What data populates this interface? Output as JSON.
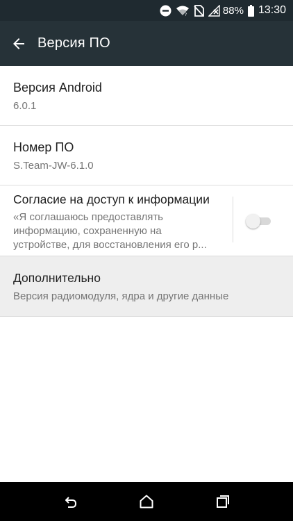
{
  "status_bar": {
    "battery_percent": "88%",
    "time": "13:30",
    "icons": [
      "do-not-disturb-icon",
      "wifi-icon",
      "no-sim-icon",
      "signal-icon",
      "battery-icon"
    ]
  },
  "app_bar": {
    "title": "Версия ПО",
    "back_icon": "arrow-back-icon"
  },
  "items": [
    {
      "title": "Версия Android",
      "subtitle": "6.0.1"
    },
    {
      "title": "Номер ПО",
      "subtitle": "S.Team-JW-6.1.0"
    },
    {
      "title": "Согласие на доступ к информации",
      "subtitle_lines": [
        "«Я соглашаюсь предоставлять",
        "информацию, сохраненную на",
        "устройстве, для восстановления его р..."
      ],
      "toggle_on": false
    },
    {
      "title": "Дополнительно",
      "subtitle": "Версия радиомодуля, ядра и другие данные"
    }
  ],
  "nav_bar": {
    "icons": [
      "back-icon",
      "home-icon",
      "recents-icon"
    ]
  },
  "colors": {
    "app_bar": "#263238",
    "status_bar": "#1f2a30",
    "highlight_row": "#eeeeee",
    "secondary_text": "#757575"
  }
}
